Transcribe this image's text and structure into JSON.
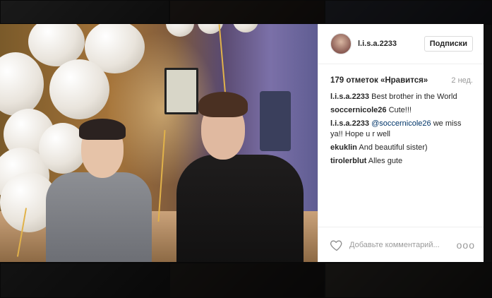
{
  "post": {
    "username": "l.i.s.a.2233",
    "follow_label": "Подписки",
    "likes": "179 отметок «Нравится»",
    "time": "2 нед.",
    "comments": [
      {
        "author": "l.i.s.a.2233",
        "text": "Best brother in the World",
        "mention": ""
      },
      {
        "author": "soccernicole26",
        "text": "Cute!!!",
        "mention": ""
      },
      {
        "author": "l.i.s.a.2233",
        "mention": "@soccernicole26",
        "text": "we miss ya!! Hope u r well"
      },
      {
        "author": "ekuklin",
        "text": "And beautiful sister)",
        "mention": ""
      },
      {
        "author": "tirolerblut",
        "text": "Alles gute",
        "mention": ""
      }
    ],
    "comment_placeholder": "Добавьте комментарий...",
    "more_label": "ooo"
  },
  "icons": {
    "heart": "heart-icon",
    "more": "more-options-icon",
    "avatar": "avatar"
  },
  "colors": {
    "text": "#262626",
    "muted": "#999999",
    "mention": "#003569",
    "border": "#efefef"
  }
}
